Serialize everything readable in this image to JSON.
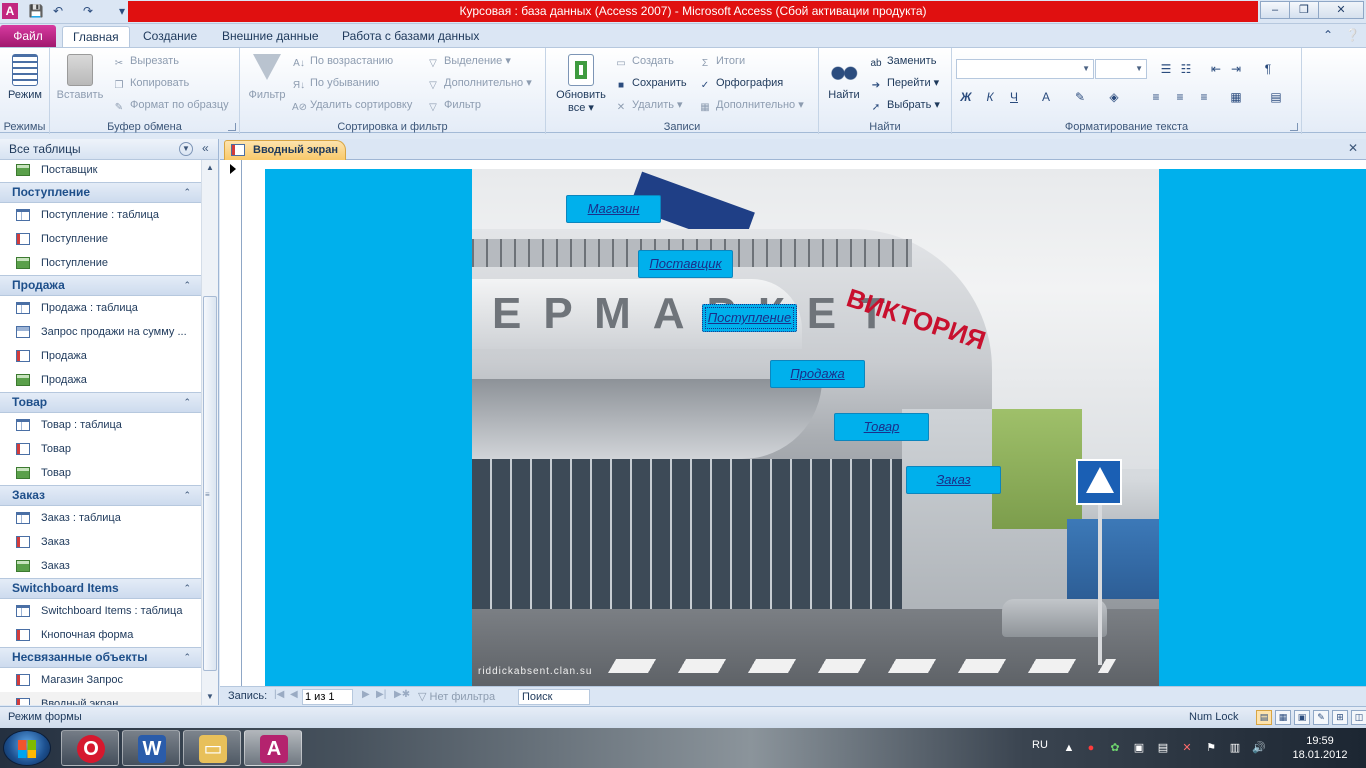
{
  "window": {
    "title": "Курсовая : база данных (Access 2007)  -  Microsoft Access (Сбой активации продукта)",
    "app_icon_letter": "A",
    "controls": {
      "minimize": "–",
      "maximize": "❐",
      "close": "✕"
    }
  },
  "ribbon_tabs": {
    "file": "Файл",
    "items": [
      "Главная",
      "Создание",
      "Внешние данные",
      "Работа с базами данных"
    ],
    "active": "Главная"
  },
  "ribbon": {
    "views": {
      "label": "Режимы",
      "button": "Режим"
    },
    "clipboard": {
      "label": "Буфер обмена",
      "paste": "Вставить",
      "cut": "Вырезать",
      "copy": "Копировать",
      "format_painter": "Формат по образцу"
    },
    "sort_filter": {
      "label": "Сортировка и фильтр",
      "filter": "Фильтр",
      "ascending": "По возрастанию",
      "descending": "По убыванию",
      "remove_sort": "Удалить сортировку",
      "selection": "Выделение",
      "advanced": "Дополнительно",
      "toggle_filter": "Фильтр"
    },
    "records": {
      "label": "Записи",
      "refresh_line1": "Обновить",
      "refresh_line2": "все",
      "new": "Создать",
      "save": "Сохранить",
      "delete": "Удалить",
      "totals": "Итоги",
      "spelling": "Орфография",
      "more": "Дополнительно"
    },
    "find": {
      "label": "Найти",
      "find": "Найти",
      "replace": "Заменить",
      "goto": "Перейти",
      "select": "Выбрать"
    },
    "text_format": {
      "label": "Форматирование текста",
      "bold": "Ж",
      "italic": "К",
      "underline": "Ч"
    }
  },
  "nav_pane": {
    "title": "Все таблицы",
    "top_item": "Поставщик",
    "groups": [
      {
        "name": "Поступление",
        "items": [
          {
            "label": "Поступление : таблица",
            "icon": "table"
          },
          {
            "label": "Поступление",
            "icon": "form"
          },
          {
            "label": "Поступление",
            "icon": "report"
          }
        ]
      },
      {
        "name": "Продажа",
        "items": [
          {
            "label": "Продажа : таблица",
            "icon": "table"
          },
          {
            "label": "Запрос продажи на сумму ...",
            "icon": "query"
          },
          {
            "label": "Продажа",
            "icon": "form"
          },
          {
            "label": "Продажа",
            "icon": "report"
          }
        ]
      },
      {
        "name": "Товар",
        "items": [
          {
            "label": "Товар : таблица",
            "icon": "table"
          },
          {
            "label": "Товар",
            "icon": "form"
          },
          {
            "label": "Товар",
            "icon": "report"
          }
        ]
      },
      {
        "name": "Заказ",
        "items": [
          {
            "label": "Заказ : таблица",
            "icon": "table"
          },
          {
            "label": "Заказ",
            "icon": "form"
          },
          {
            "label": "Заказ",
            "icon": "report"
          }
        ]
      },
      {
        "name": "Switchboard Items",
        "items": [
          {
            "label": "Switchboard Items : таблица",
            "icon": "table"
          },
          {
            "label": "Кнопочная форма",
            "icon": "form"
          }
        ]
      },
      {
        "name": "Несвязанные объекты",
        "items": [
          {
            "label": "Магазин Запрос",
            "icon": "form"
          },
          {
            "label": "Вводный экран",
            "icon": "form",
            "selected": true
          }
        ]
      }
    ]
  },
  "document": {
    "tab_title": "Вводный экран",
    "watermark": "riddickabsent.clan.su",
    "sign_text": "ЕРМАРКЕТ",
    "logo_text": "ВИКТОРИЯ",
    "buttons": [
      "Магазин",
      "Поставщик",
      "Поступление",
      "Продажа",
      "Товар",
      "Заказ"
    ],
    "focused_button": "Поступление"
  },
  "record_nav": {
    "label": "Запись:",
    "current": "1 из 1",
    "filter": "Нет фильтра",
    "search": "Поиск"
  },
  "status": {
    "mode": "Режим формы",
    "numlock": "Num Lock"
  },
  "taskbar": {
    "lang": "RU",
    "time": "19:59",
    "date": "18.01.2012"
  },
  "colors": {
    "title_red": "#e01010",
    "form_background": "#00b0ec",
    "file_tab": "#c2277f",
    "doc_tab": "#f9c96a"
  }
}
